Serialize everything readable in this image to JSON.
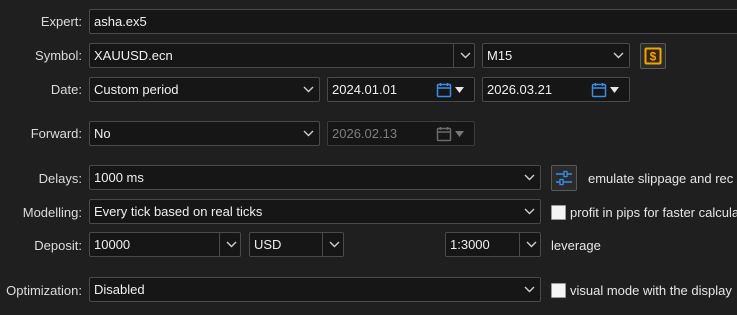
{
  "expert": {
    "label": "Expert:",
    "value": "asha.ex5"
  },
  "symbol": {
    "label": "Symbol:",
    "value": "XAUUSD.ecn",
    "timeframe": "M15",
    "icon": "dollar-icon"
  },
  "date": {
    "label": "Date:",
    "period": "Custom period",
    "from": "2024.01.01",
    "to": "2026.03.21",
    "icon": "calendar-icon"
  },
  "forward": {
    "label": "Forward:",
    "value": "No",
    "date": "2026.02.13"
  },
  "delays": {
    "label": "Delays:",
    "value": "1000 ms",
    "option_text": "emulate slippage and rec",
    "icon": "sliders-icon"
  },
  "modelling": {
    "label": "Modelling:",
    "value": "Every tick based on real ticks",
    "option_text": "profit in pips for faster calcula"
  },
  "deposit": {
    "label": "Deposit:",
    "amount": "10000",
    "currency": "USD",
    "leverage_value": "1:3000",
    "leverage_text": "leverage"
  },
  "optimization": {
    "label": "Optimization:",
    "value": "Disabled",
    "option_text": "visual mode with the display"
  },
  "colors": {
    "background": "#1f1f1f",
    "field": "#161616",
    "calendar": "#3a8ee6",
    "dollar_badge": "#f0a500"
  }
}
